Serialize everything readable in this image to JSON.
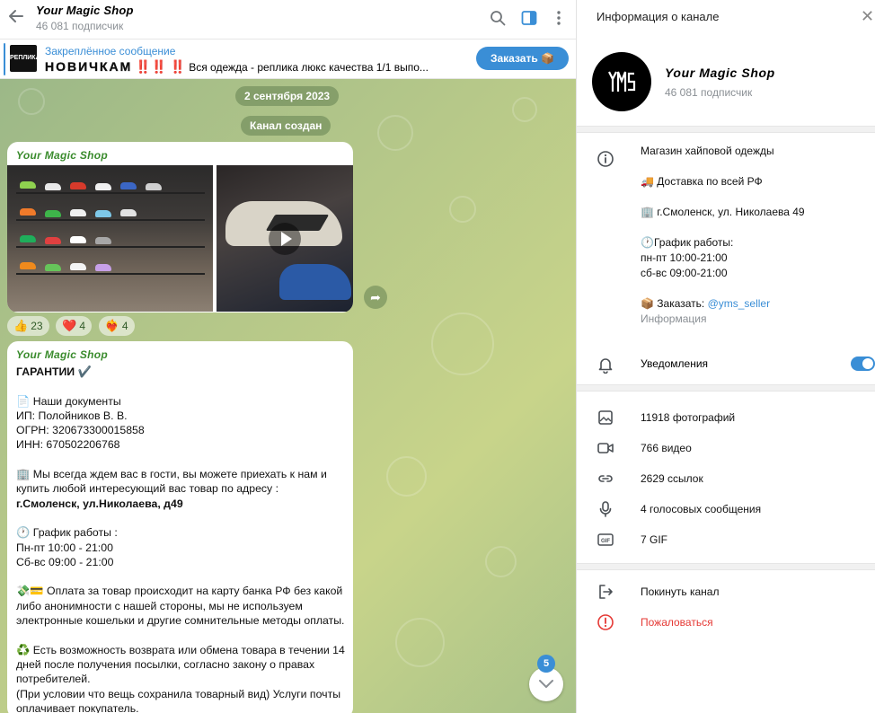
{
  "chat_header": {
    "title": "Your Magic Shop",
    "subtitle": "46 081 подписчик"
  },
  "pinned": {
    "label": "Закреплённое сообщение",
    "thumb_text": "РЕПЛИКА",
    "text_big": "НОВИЧКАМ",
    "text_excl": "‼️‼️ ‼️",
    "text_rest": "Вся одежда - реплика люкс качества 1/1 выпо..."
  },
  "order_button": {
    "label": "Заказать 📦"
  },
  "service": {
    "date": "2 сентября 2023",
    "created": "Канал создан"
  },
  "post1": {
    "author": "Your Magic Shop",
    "reactions": [
      {
        "emoji": "👍",
        "count": "23"
      },
      {
        "emoji": "❤️",
        "count": "4"
      },
      {
        "emoji": "❤️‍🔥",
        "count": "4"
      }
    ]
  },
  "post2": {
    "author": "Your Magic Shop",
    "lines": [
      {
        "t": "ГАРАНТИИ ✔️",
        "b": true
      },
      {
        "t": "",
        "b": false
      },
      {
        "t": "📄 Наши документы",
        "b": false
      },
      {
        "t": "ИП: Полойников  В. В.",
        "b": false
      },
      {
        "t": "ОГРН: 320673300015858",
        "b": false
      },
      {
        "t": "ИНН: 670502206768",
        "b": false
      },
      {
        "t": "",
        "b": false
      },
      {
        "t": "🏢 Мы всегда ждем вас в гости, вы можете приехать к нам и",
        "b": false
      },
      {
        "t": "купить любой интересующий вас товар по адресу :",
        "b": false
      },
      {
        "t": "г.Смоленск, ул.Николаева, д49",
        "b": true
      },
      {
        "t": "",
        "b": false
      },
      {
        "t": "🕐 График работы :",
        "b": false
      },
      {
        "t": "Пн-пт 10:00 - 21:00",
        "b": false
      },
      {
        "t": "Сб-вс 09:00 - 21:00",
        "b": false
      },
      {
        "t": "",
        "b": false
      },
      {
        "t": "💸💳 Оплата за товар происходит на карту банка РФ без какой",
        "b": false
      },
      {
        "t": "либо анонимности с нашей стороны, мы не используем",
        "b": false
      },
      {
        "t": "электронные кошельки и другие сомнительные методы оплаты.",
        "b": false
      },
      {
        "t": "",
        "b": false
      },
      {
        "t": "♻️ Есть возможность возврата или обмена товара в течении 14",
        "b": false
      },
      {
        "t": "дней после получения посылки, согласно закону о правах",
        "b": false
      },
      {
        "t": "потребителей.",
        "b": false
      },
      {
        "t": "(При условии что вещь сохранила товарный вид) Услуги почты",
        "b": false
      },
      {
        "t": "оплачивает покупатель.",
        "b": false
      }
    ]
  },
  "scroll": {
    "unread": "5"
  },
  "info_panel": {
    "title": "Информация о канале",
    "channel_name": "Your Magic Shop",
    "subscribers": "46 081 подписчик",
    "description": [
      {
        "t": "Магазин хайповой одежды",
        "kind": "text"
      },
      {
        "t": "",
        "kind": "gap"
      },
      {
        "t": "🚚 Доставка по всей  РФ",
        "kind": "text"
      },
      {
        "t": "",
        "kind": "gap"
      },
      {
        "t": "🏢 г.Смоленск, ул. Николаева 49",
        "kind": "text"
      },
      {
        "t": "",
        "kind": "gap"
      },
      {
        "t": "🕐График работы:",
        "kind": "text"
      },
      {
        "t": "пн-пт 10:00-21:00",
        "kind": "text"
      },
      {
        "t": "сб-вс 09:00-21:00",
        "kind": "text"
      },
      {
        "t": "",
        "kind": "gap"
      }
    ],
    "order_prefix": "📦 Заказать: ",
    "order_link": "@yms_seller",
    "info_caption": "Информация",
    "notifications_label": "Уведомления",
    "notifications_on": true,
    "stats": [
      {
        "icon": "photo-icon",
        "label": "11918 фотографий"
      },
      {
        "icon": "video-icon",
        "label": "766 видео"
      },
      {
        "icon": "link-icon",
        "label": "2629 ссылок"
      },
      {
        "icon": "microphone-icon",
        "label": "4 голосовых сообщения"
      },
      {
        "icon": "gif-icon",
        "label": "7 GIF"
      }
    ],
    "leave_label": "Покинуть канал",
    "report_label": "Пожаловаться"
  },
  "colors": {
    "accent": "#3a8ed6",
    "author_green": "#3b8c2e",
    "danger": "#e53935",
    "chat_bg": "#b6c889"
  }
}
